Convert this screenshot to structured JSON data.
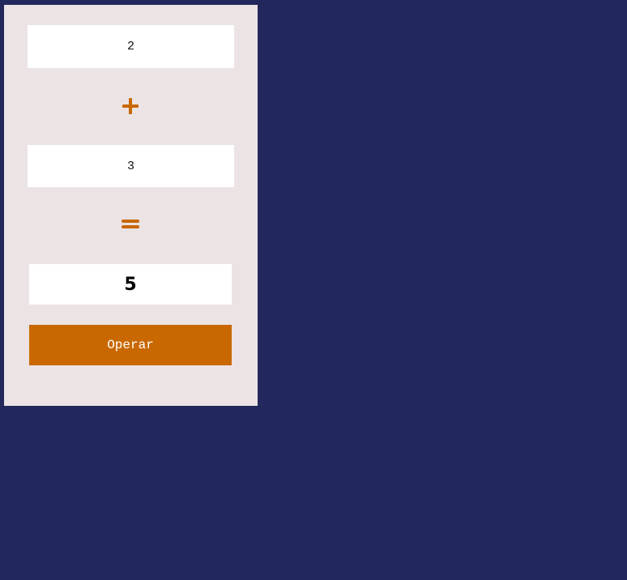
{
  "form": {
    "operand_a": "2",
    "operator_symbol": "+",
    "operand_b": "3",
    "equals_symbol": "=",
    "result": "5",
    "submit_label": "Operar"
  },
  "icons": {
    "operator": "plus-icon",
    "equals": "equals-icon"
  },
  "colors": {
    "page_background": "#22285c",
    "panel_background": "#ece3e5",
    "accent": "#c96800",
    "field_background": "#ffffff"
  }
}
